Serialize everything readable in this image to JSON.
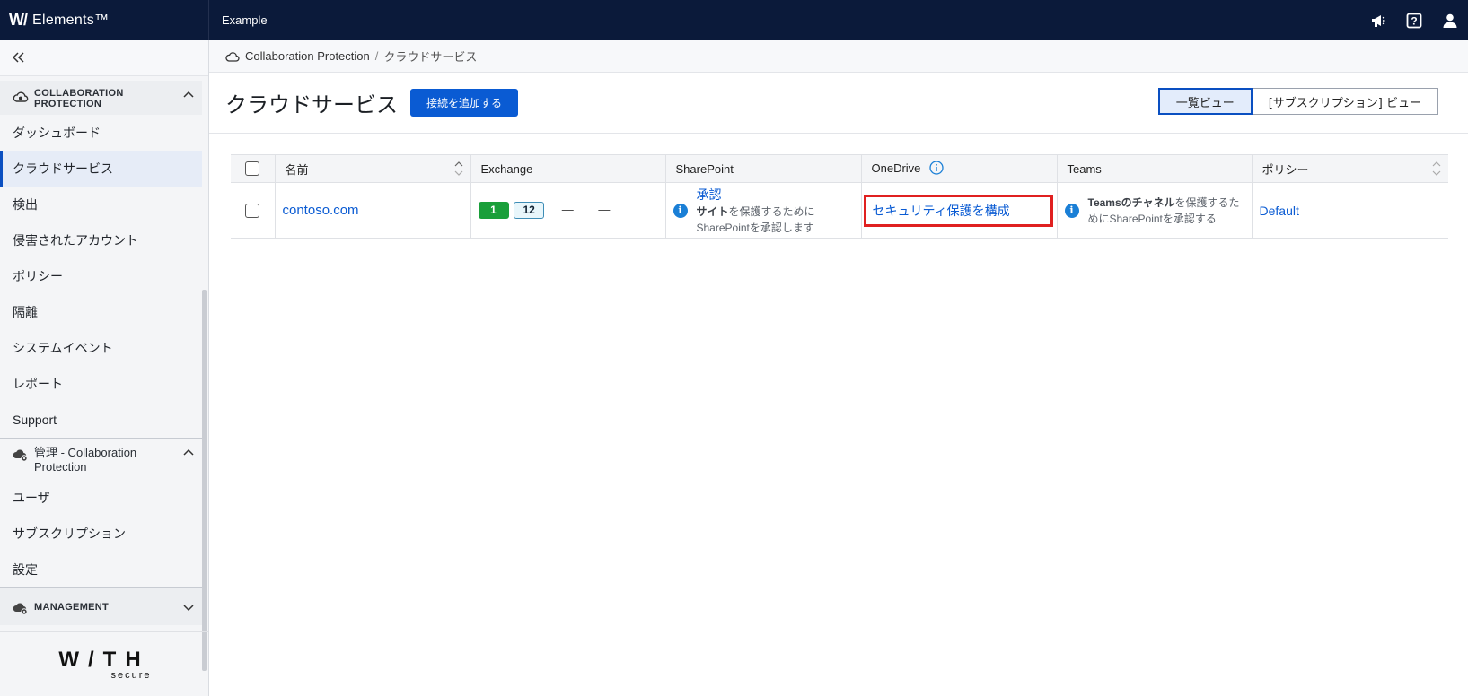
{
  "topbar": {
    "logo_mark": "W/",
    "product": "Elements™",
    "org": "Example",
    "icons": [
      "megaphone-icon",
      "help-icon",
      "user-icon"
    ]
  },
  "sidebar": {
    "section1": {
      "title": "COLLABORATION PROTECTION"
    },
    "items1": [
      {
        "label": "ダッシュボード"
      },
      {
        "label": "クラウドサービス",
        "active": true
      },
      {
        "label": "検出"
      },
      {
        "label": "侵害されたアカウント"
      },
      {
        "label": "ポリシー"
      },
      {
        "label": "隔離"
      },
      {
        "label": "システムイベント"
      },
      {
        "label": "レポート"
      },
      {
        "label": "Support"
      }
    ],
    "section2": {
      "title": "管理 - Collaboration Protection"
    },
    "items2": [
      {
        "label": "ユーザ"
      },
      {
        "label": "サブスクリプション"
      },
      {
        "label": "設定"
      }
    ],
    "section3": {
      "title": "MANAGEMENT"
    },
    "footer": {
      "word": "W/TH",
      "sub": "secure"
    }
  },
  "breadcrumb": {
    "root": "Collaboration Protection",
    "sep": "/",
    "current": "クラウドサービス"
  },
  "page": {
    "title": "クラウドサービス",
    "add_button": "接続を追加する",
    "view_list": "一覧ビュー",
    "view_subscription": "[サブスクリプション] ビュー"
  },
  "table": {
    "headers": {
      "name": "名前",
      "exchange": "Exchange",
      "sharepoint": "SharePoint",
      "onedrive": "OneDrive",
      "teams": "Teams",
      "policy": "ポリシー"
    },
    "row": {
      "name": "contoso.com",
      "exchange_count_green": "1",
      "exchange_count_outline": "12",
      "exchange_dash1": "—",
      "exchange_dash2": "—",
      "sharepoint_link": "承認",
      "sharepoint_text_bold": "サイト",
      "sharepoint_text": "を保護するために",
      "sharepoint_text2": "SharePointを承認します",
      "onedrive_link": "セキュリティ保護を構成",
      "teams_text_bold": "Teamsのチャネル",
      "teams_text": "を保護するた",
      "teams_text2": "めにSharePointを承認する",
      "policy": "Default"
    }
  },
  "colors": {
    "topbar": "#0b1a3a",
    "primary": "#0a5bd3",
    "highlight": "#e02020",
    "badge_green": "#1a9f3a"
  }
}
